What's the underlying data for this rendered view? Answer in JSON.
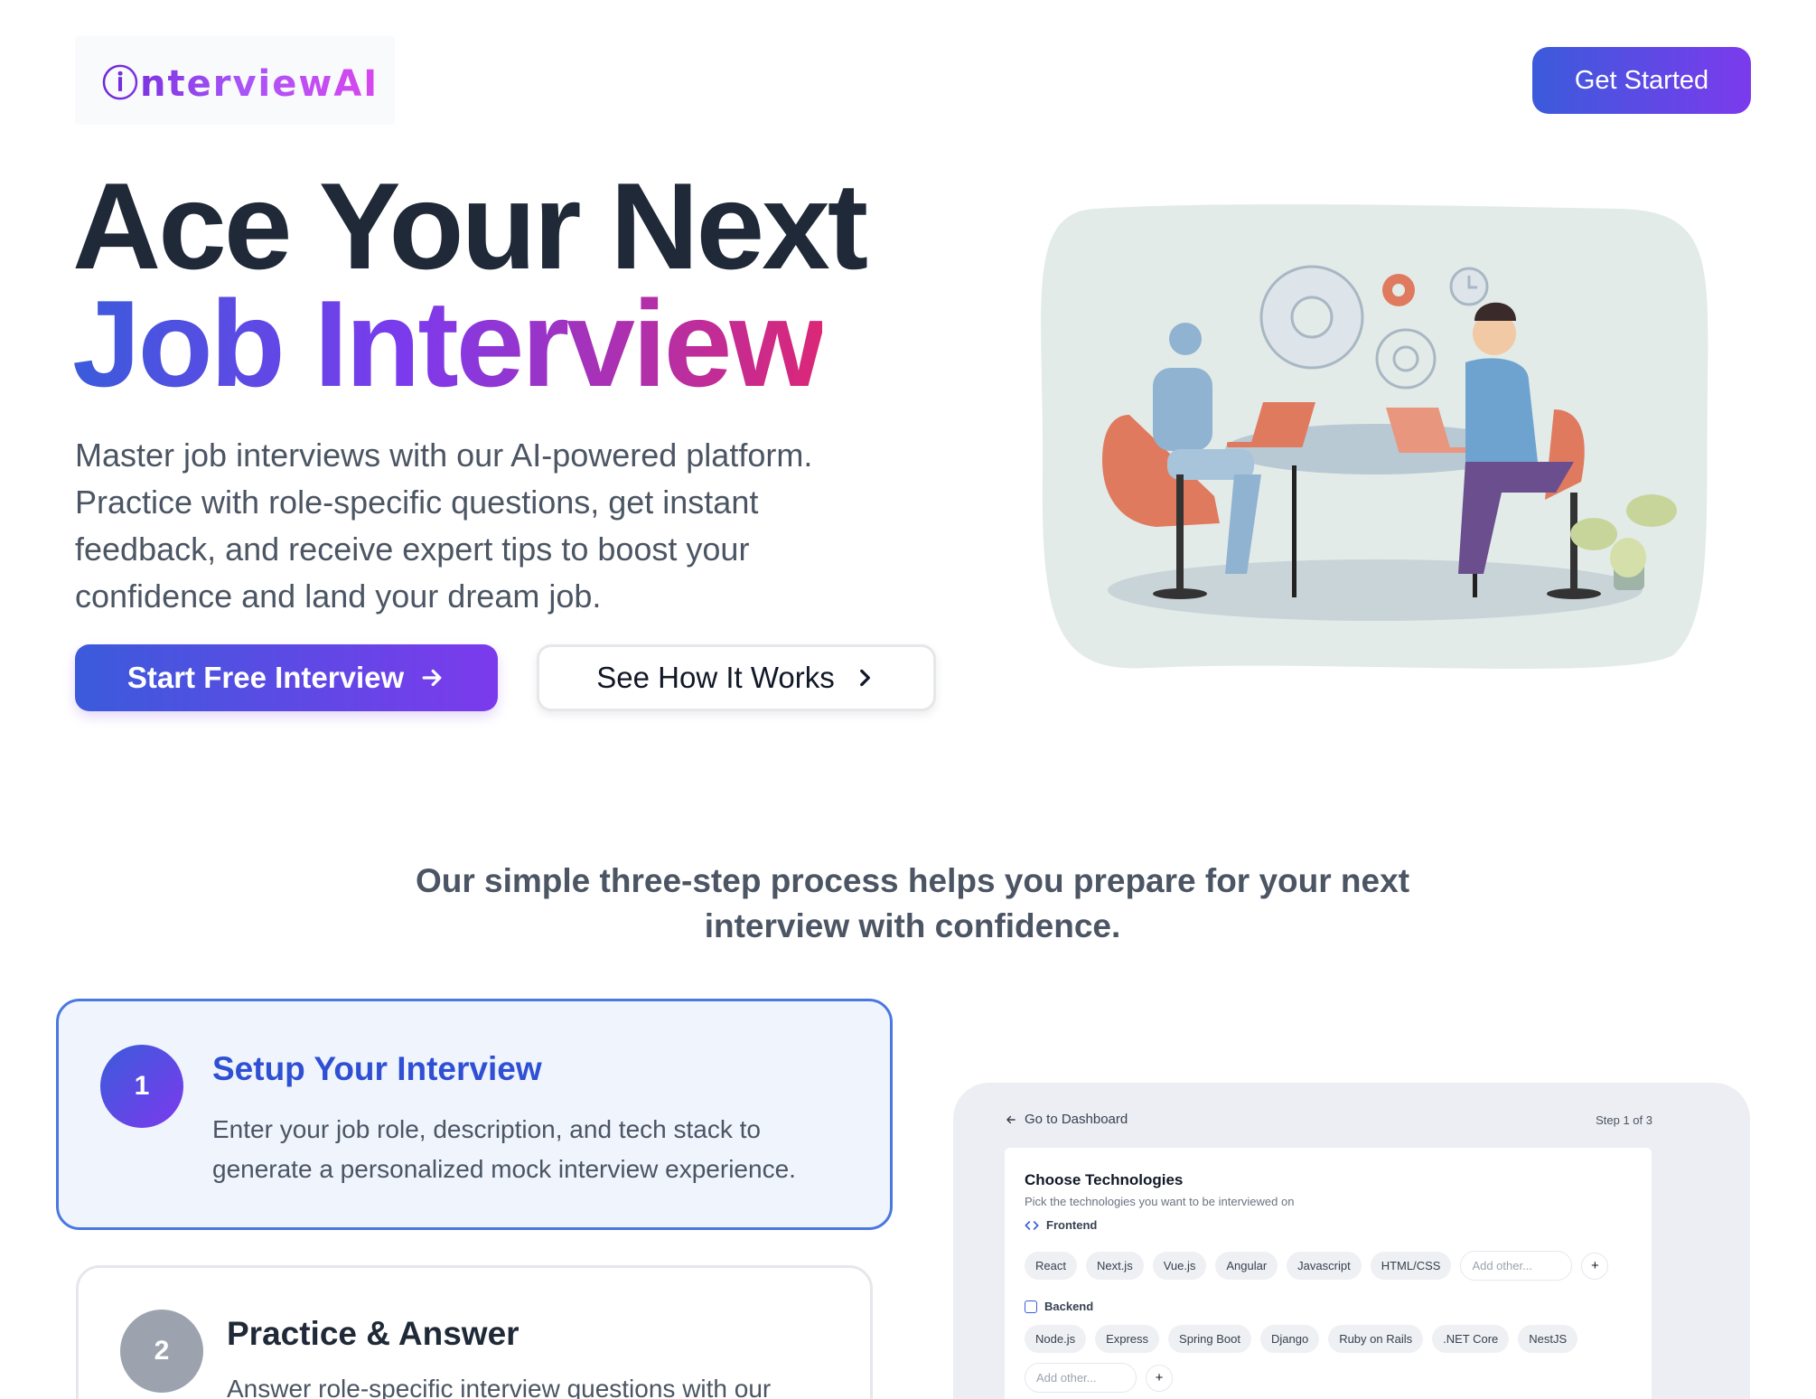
{
  "header": {
    "logo_text": "ⓘnterviewAI",
    "cta_label": "Get Started"
  },
  "hero": {
    "title_line1": "Ace Your Next",
    "title_line2": "Job Interview",
    "subtitle": "Master job interviews with our AI-powered platform. Practice with role-specific questions, get instant feedback, and receive expert tips to boost your confidence and land your dream job.",
    "primary_button": "Start Free Interview",
    "secondary_button": "See How It Works"
  },
  "process": {
    "intro": "Our simple three-step process helps you prepare for your next interview with confidence.",
    "steps": [
      {
        "number": "1",
        "title": "Setup Your Interview",
        "description": "Enter your job role, description, and tech stack to generate a personalized mock interview experience."
      },
      {
        "number": "2",
        "title": "Practice & Answer",
        "description": "Answer role-specific interview questions with our"
      }
    ]
  },
  "preview": {
    "back_link": "Go to Dashboard",
    "step_indicator": "Step 1 of 3",
    "heading": "Choose Technologies",
    "subheading": "Pick the technologies you want to be interviewed on",
    "frontend_label": "Frontend",
    "frontend_chips": [
      "React",
      "Next.js",
      "Vue.js",
      "Angular",
      "Javascript",
      "HTML/CSS"
    ],
    "backend_label": "Backend",
    "backend_chips": [
      "Node.js",
      "Express",
      "Spring Boot",
      "Django",
      "Ruby on Rails",
      ".NET Core",
      "NestJS"
    ],
    "add_other_placeholder": "Add other...",
    "plus": "+"
  },
  "colors": {
    "brand_blue": "#3b5bdb",
    "brand_purple": "#7c3aed",
    "brand_pink": "#db2777",
    "active_step_border": "#4a78e0"
  },
  "icons": [
    "arrow-right-icon",
    "chevron-right-icon",
    "arrow-left-icon",
    "code-icon",
    "server-icon",
    "plus-icon"
  ]
}
